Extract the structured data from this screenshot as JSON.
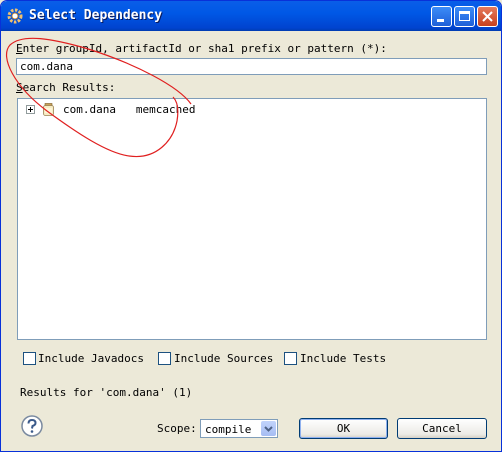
{
  "window": {
    "title": "Select Dependency"
  },
  "search": {
    "label_key": "E",
    "label_rest": "nter groupId, artifactId or sha1 prefix or pattern (*):",
    "value": "com.dana"
  },
  "results": {
    "label_key": "S",
    "label_rest": "earch Results:",
    "items": [
      {
        "group": "com.dana",
        "artifact": "memcached"
      }
    ]
  },
  "options": {
    "include_javadocs": "Include Javadocs",
    "include_sources": "Include Sources",
    "include_tests": "Include Tests"
  },
  "status": "Results for 'com.dana' (1)",
  "scope": {
    "label": "Scope:",
    "value": "compile"
  },
  "buttons": {
    "ok": "OK",
    "cancel": "Cancel"
  },
  "colors": {
    "titlebar": "#0058e6",
    "annotation": "#e02020"
  },
  "icons": {
    "window": "gear-icon",
    "help": "help-icon",
    "item": "jar-icon"
  }
}
